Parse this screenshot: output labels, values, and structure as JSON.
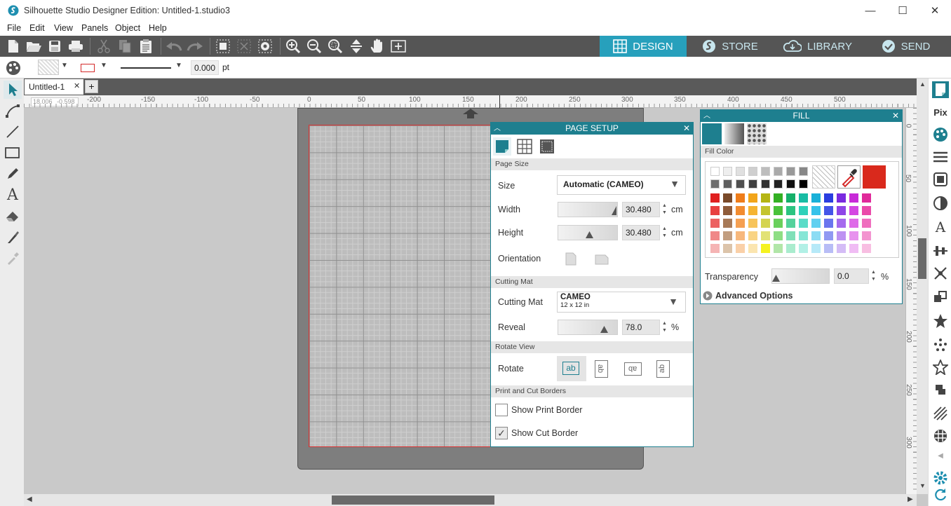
{
  "window": {
    "title": "Silhouette Studio Designer Edition: Untitled-1.studio3",
    "minimize": "—",
    "maximize": "☐",
    "close": "✕"
  },
  "menu": [
    "File",
    "Edit",
    "View",
    "Panels",
    "Object",
    "Help"
  ],
  "nav_tabs": [
    {
      "label": "DESIGN",
      "icon": "grid-icon",
      "active": true
    },
    {
      "label": "STORE",
      "icon": "silhouette-s-icon",
      "active": false
    },
    {
      "label": "LIBRARY",
      "icon": "cloud-icon",
      "active": false
    },
    {
      "label": "SEND",
      "icon": "check-circle-icon",
      "active": false
    }
  ],
  "propbar": {
    "line_width": "0.000",
    "unit": "pt"
  },
  "document": {
    "tab": "Untitled-1",
    "close": "✕",
    "add": "+"
  },
  "ruler": {
    "cursor_x": "18.006",
    "cursor_y": "-0.598",
    "h_labels": [
      "-200",
      "-150",
      "-100",
      "-50",
      "0",
      "50",
      "100",
      "150",
      "200",
      "250",
      "300",
      "350",
      "400",
      "450",
      "500"
    ],
    "v_labels": [
      "0",
      "50",
      "100",
      "150",
      "200",
      "250",
      "300"
    ]
  },
  "page_setup": {
    "title": "PAGE SETUP",
    "sections": {
      "page_size": "Page Size",
      "cutting_mat": "Cutting Mat",
      "rotate_view": "Rotate View",
      "borders": "Print and Cut Borders"
    },
    "size_label": "Size",
    "size_value": "Automatic (CAMEO)",
    "width_label": "Width",
    "width_value": "30.480",
    "height_label": "Height",
    "height_value": "30.480",
    "length_unit": "cm",
    "orientation_label": "Orientation",
    "mat_label": "Cutting Mat",
    "mat_value": "CAMEO",
    "mat_size": "12 x 12 in",
    "reveal_label": "Reveal",
    "reveal_value": "78.0",
    "reveal_unit": "%",
    "rotate_label": "Rotate",
    "rotate_glyph": "ab",
    "show_print_border": "Show Print Border",
    "show_print_border_checked": false,
    "show_cut_border": "Show Cut Border",
    "show_cut_border_checked": true,
    "check_glyph": "✓"
  },
  "fill_panel": {
    "title": "FILL",
    "fill_color_label": "Fill Color",
    "transparency_label": "Transparency",
    "transparency_value": "0.0",
    "transparency_unit": "%",
    "advanced_options": "Advanced Options",
    "selected_color": "#d9291c",
    "grey_row1": [
      "#ffffff",
      "#eeeeee",
      "#e0e0e0",
      "#cfcfcf",
      "#bdbdbd",
      "#aaaaaa",
      "#999999",
      "#878787"
    ],
    "grey_row2": [
      "#6e6e6e",
      "#5f5f5f",
      "#4f4f4f",
      "#404040",
      "#313131",
      "#222222",
      "#111111",
      "#000000"
    ],
    "color_rows": [
      [
        "#e02020",
        "#7a4a2a",
        "#ef7d1a",
        "#f2a51a",
        "#b5b514",
        "#33b023",
        "#16b06a",
        "#18bca4",
        "#1ab0d8",
        "#2a3ee0",
        "#7a2ae0",
        "#c82ad8",
        "#e02a9a"
      ],
      [
        "#e84040",
        "#8f5c3a",
        "#f28c30",
        "#f5b432",
        "#c4c42e",
        "#49c23a",
        "#2cc481",
        "#2ed1ba",
        "#36c2ea",
        "#4455e8",
        "#8f45e8",
        "#d446e2",
        "#ea4aaa"
      ],
      [
        "#ec6262",
        "#a87a58",
        "#f5a052",
        "#f7c45a",
        "#d4d450",
        "#6ad05c",
        "#55d29c",
        "#5adcc8",
        "#62d0f0",
        "#6a76ee",
        "#a66aee",
        "#de6ae8",
        "#ef6ebe"
      ],
      [
        "#f08888",
        "#c29e80",
        "#f7b87c",
        "#f9d484",
        "#e2e276",
        "#8ede84",
        "#80e0b8",
        "#86e6d6",
        "#8cdcf4",
        "#9099f2",
        "#bd92f2",
        "#e792ee",
        "#f394d0"
      ],
      [
        "#f5b4b4",
        "#dcc4aa",
        "#fad0a8",
        "#fbe5b0",
        "#f5f220",
        "#b2e6a8",
        "#aaecce",
        "#b2f0e6",
        "#b6e9f8",
        "#b8bdf6",
        "#d4bcf6",
        "#f0bcf4",
        "#f8bee2"
      ]
    ]
  }
}
